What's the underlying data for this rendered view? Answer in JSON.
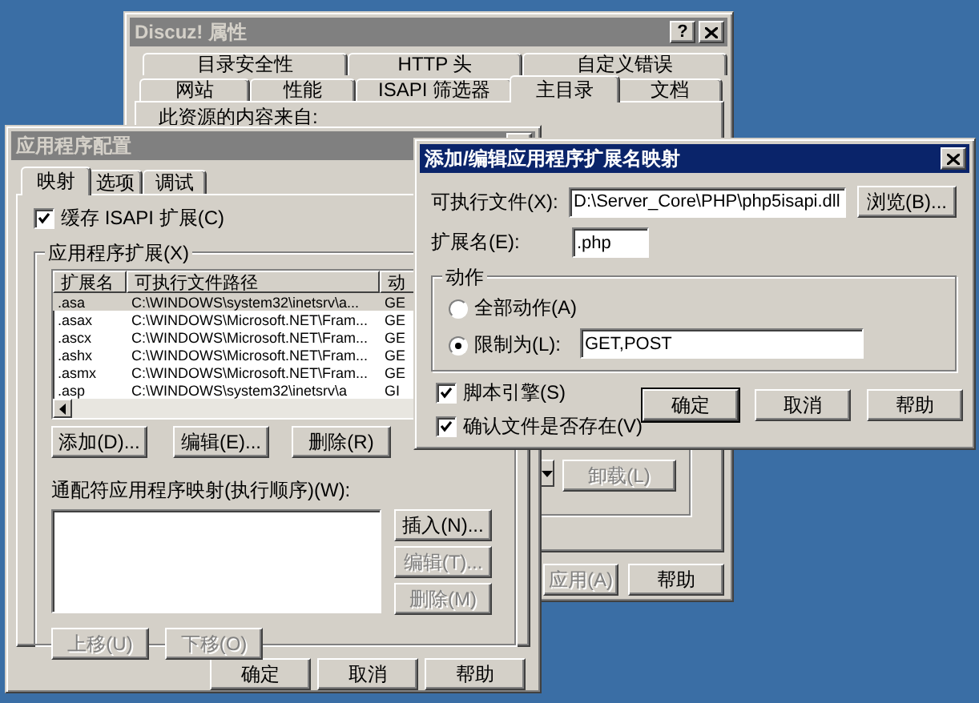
{
  "properties_window": {
    "title": "Discuz! 属性",
    "active": false,
    "help_button": "?",
    "tab_rows": [
      [
        {
          "label": "目录安全性",
          "selected": false
        },
        {
          "label": "HTTP 头",
          "selected": false
        },
        {
          "label": "自定义错误",
          "selected": false
        }
      ],
      [
        {
          "label": "网站",
          "selected": false
        },
        {
          "label": "性能",
          "selected": false
        },
        {
          "label": "ISAPI 筛选器",
          "selected": false
        },
        {
          "label": "主目录",
          "selected": true
        },
        {
          "label": "文档",
          "selected": false
        }
      ]
    ],
    "content_label": "此资源的内容来自:",
    "unload_button": {
      "label": "卸载(L)",
      "disabled": true
    },
    "buttons": [
      {
        "label": "应用(A)",
        "disabled": true
      },
      {
        "label": "帮助",
        "disabled": false
      }
    ]
  },
  "config_window": {
    "title": "应用程序配置",
    "active": false,
    "tabs": [
      {
        "label": "映射",
        "selected": true
      },
      {
        "label": "选项",
        "selected": false
      },
      {
        "label": "调试",
        "selected": false
      }
    ],
    "cache_checkbox": {
      "label": "缓存 ISAPI 扩展(C)",
      "checked": true
    },
    "extensions_group": {
      "label": "应用程序扩展(X)",
      "columns": [
        "扩展名",
        "可执行文件路径",
        "动"
      ],
      "rows": [
        {
          "cells": [
            ".asa",
            "C:\\WINDOWS\\system32\\inetsrv\\a...",
            "GE"
          ],
          "selected": true
        },
        {
          "cells": [
            ".asax",
            "C:\\WINDOWS\\Microsoft.NET\\Fram...",
            "GE"
          ],
          "selected": false
        },
        {
          "cells": [
            ".ascx",
            "C:\\WINDOWS\\Microsoft.NET\\Fram...",
            "GE"
          ],
          "selected": false
        },
        {
          "cells": [
            ".ashx",
            "C:\\WINDOWS\\Microsoft.NET\\Fram...",
            "GE"
          ],
          "selected": false
        },
        {
          "cells": [
            ".asmx",
            "C:\\WINDOWS\\Microsoft.NET\\Fram...",
            "GE"
          ],
          "selected": false
        },
        {
          "cells": [
            ".asp",
            "C:\\WINDOWS\\system32\\inetsrv\\a",
            "GI"
          ],
          "selected": false
        }
      ],
      "buttons": [
        {
          "label": "添加(D)...",
          "disabled": false
        },
        {
          "label": "编辑(E)...",
          "disabled": false
        },
        {
          "label": "删除(R)",
          "disabled": false
        }
      ]
    },
    "wildcard_label": "通配符应用程序映射(执行顺序)(W):",
    "wildcard_buttons": [
      {
        "label": "插入(N)...",
        "disabled": false
      },
      {
        "label": "编辑(T)...",
        "disabled": true
      },
      {
        "label": "删除(M)",
        "disabled": true
      }
    ],
    "order_buttons": [
      {
        "label": "上移(U)",
        "disabled": true
      },
      {
        "label": "下移(O)",
        "disabled": true
      }
    ],
    "buttons": [
      {
        "label": "确定",
        "disabled": false
      },
      {
        "label": "取消",
        "disabled": false
      },
      {
        "label": "帮助",
        "disabled": false
      }
    ]
  },
  "mapping_dialog": {
    "title": "添加/编辑应用程序扩展名映射",
    "active": true,
    "executable": {
      "label": "可执行文件(X):",
      "value": "D:\\Server_Core\\PHP\\php5isapi.dll"
    },
    "browse_button": {
      "label": "浏览(B)...",
      "disabled": false
    },
    "extension": {
      "label": "扩展名(E):",
      "value": ".php"
    },
    "verbs_group": {
      "label": "动作",
      "options": [
        {
          "label": "全部动作(A)",
          "selected": false
        },
        {
          "label": "限制为(L):",
          "selected": true,
          "value": "GET,POST"
        }
      ]
    },
    "checkboxes": [
      {
        "label": "脚本引擎(S)",
        "checked": true
      },
      {
        "label": "确认文件是否存在(V)",
        "checked": true
      }
    ],
    "buttons": [
      {
        "label": "确定",
        "disabled": false,
        "default": true
      },
      {
        "label": "取消",
        "disabled": false,
        "default": false
      },
      {
        "label": "帮助",
        "disabled": false,
        "default": false
      }
    ]
  }
}
